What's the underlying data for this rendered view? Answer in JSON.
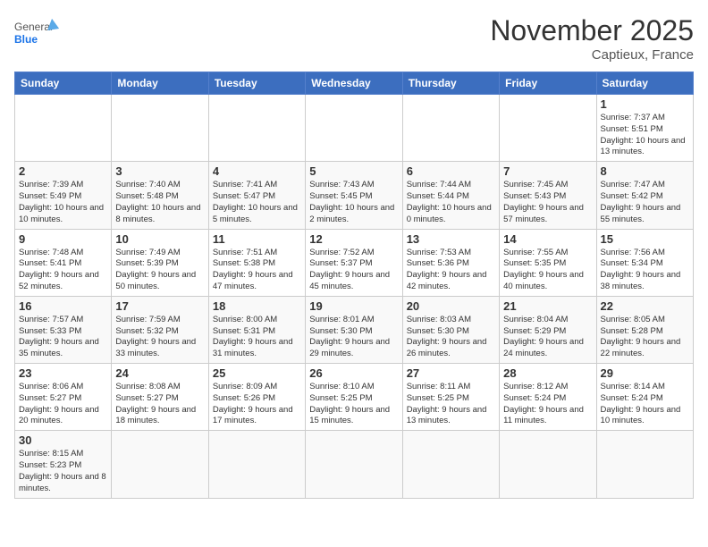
{
  "header": {
    "logo_general": "General",
    "logo_blue": "Blue",
    "month_title": "November 2025",
    "location": "Captieux, France"
  },
  "days_of_week": [
    "Sunday",
    "Monday",
    "Tuesday",
    "Wednesday",
    "Thursday",
    "Friday",
    "Saturday"
  ],
  "weeks": [
    [
      {
        "day": "",
        "info": ""
      },
      {
        "day": "",
        "info": ""
      },
      {
        "day": "",
        "info": ""
      },
      {
        "day": "",
        "info": ""
      },
      {
        "day": "",
        "info": ""
      },
      {
        "day": "",
        "info": ""
      },
      {
        "day": "1",
        "info": "Sunrise: 7:37 AM\nSunset: 5:51 PM\nDaylight: 10 hours and 13 minutes."
      }
    ],
    [
      {
        "day": "2",
        "info": "Sunrise: 7:39 AM\nSunset: 5:49 PM\nDaylight: 10 hours and 10 minutes."
      },
      {
        "day": "3",
        "info": "Sunrise: 7:40 AM\nSunset: 5:48 PM\nDaylight: 10 hours and 8 minutes."
      },
      {
        "day": "4",
        "info": "Sunrise: 7:41 AM\nSunset: 5:47 PM\nDaylight: 10 hours and 5 minutes."
      },
      {
        "day": "5",
        "info": "Sunrise: 7:43 AM\nSunset: 5:45 PM\nDaylight: 10 hours and 2 minutes."
      },
      {
        "day": "6",
        "info": "Sunrise: 7:44 AM\nSunset: 5:44 PM\nDaylight: 10 hours and 0 minutes."
      },
      {
        "day": "7",
        "info": "Sunrise: 7:45 AM\nSunset: 5:43 PM\nDaylight: 9 hours and 57 minutes."
      },
      {
        "day": "8",
        "info": "Sunrise: 7:47 AM\nSunset: 5:42 PM\nDaylight: 9 hours and 55 minutes."
      }
    ],
    [
      {
        "day": "9",
        "info": "Sunrise: 7:48 AM\nSunset: 5:41 PM\nDaylight: 9 hours and 52 minutes."
      },
      {
        "day": "10",
        "info": "Sunrise: 7:49 AM\nSunset: 5:39 PM\nDaylight: 9 hours and 50 minutes."
      },
      {
        "day": "11",
        "info": "Sunrise: 7:51 AM\nSunset: 5:38 PM\nDaylight: 9 hours and 47 minutes."
      },
      {
        "day": "12",
        "info": "Sunrise: 7:52 AM\nSunset: 5:37 PM\nDaylight: 9 hours and 45 minutes."
      },
      {
        "day": "13",
        "info": "Sunrise: 7:53 AM\nSunset: 5:36 PM\nDaylight: 9 hours and 42 minutes."
      },
      {
        "day": "14",
        "info": "Sunrise: 7:55 AM\nSunset: 5:35 PM\nDaylight: 9 hours and 40 minutes."
      },
      {
        "day": "15",
        "info": "Sunrise: 7:56 AM\nSunset: 5:34 PM\nDaylight: 9 hours and 38 minutes."
      }
    ],
    [
      {
        "day": "16",
        "info": "Sunrise: 7:57 AM\nSunset: 5:33 PM\nDaylight: 9 hours and 35 minutes."
      },
      {
        "day": "17",
        "info": "Sunrise: 7:59 AM\nSunset: 5:32 PM\nDaylight: 9 hours and 33 minutes."
      },
      {
        "day": "18",
        "info": "Sunrise: 8:00 AM\nSunset: 5:31 PM\nDaylight: 9 hours and 31 minutes."
      },
      {
        "day": "19",
        "info": "Sunrise: 8:01 AM\nSunset: 5:30 PM\nDaylight: 9 hours and 29 minutes."
      },
      {
        "day": "20",
        "info": "Sunrise: 8:03 AM\nSunset: 5:30 PM\nDaylight: 9 hours and 26 minutes."
      },
      {
        "day": "21",
        "info": "Sunrise: 8:04 AM\nSunset: 5:29 PM\nDaylight: 9 hours and 24 minutes."
      },
      {
        "day": "22",
        "info": "Sunrise: 8:05 AM\nSunset: 5:28 PM\nDaylight: 9 hours and 22 minutes."
      }
    ],
    [
      {
        "day": "23",
        "info": "Sunrise: 8:06 AM\nSunset: 5:27 PM\nDaylight: 9 hours and 20 minutes."
      },
      {
        "day": "24",
        "info": "Sunrise: 8:08 AM\nSunset: 5:27 PM\nDaylight: 9 hours and 18 minutes."
      },
      {
        "day": "25",
        "info": "Sunrise: 8:09 AM\nSunset: 5:26 PM\nDaylight: 9 hours and 17 minutes."
      },
      {
        "day": "26",
        "info": "Sunrise: 8:10 AM\nSunset: 5:25 PM\nDaylight: 9 hours and 15 minutes."
      },
      {
        "day": "27",
        "info": "Sunrise: 8:11 AM\nSunset: 5:25 PM\nDaylight: 9 hours and 13 minutes."
      },
      {
        "day": "28",
        "info": "Sunrise: 8:12 AM\nSunset: 5:24 PM\nDaylight: 9 hours and 11 minutes."
      },
      {
        "day": "29",
        "info": "Sunrise: 8:14 AM\nSunset: 5:24 PM\nDaylight: 9 hours and 10 minutes."
      }
    ],
    [
      {
        "day": "30",
        "info": "Sunrise: 8:15 AM\nSunset: 5:23 PM\nDaylight: 9 hours and 8 minutes."
      },
      {
        "day": "",
        "info": ""
      },
      {
        "day": "",
        "info": ""
      },
      {
        "day": "",
        "info": ""
      },
      {
        "day": "",
        "info": ""
      },
      {
        "day": "",
        "info": ""
      },
      {
        "day": "",
        "info": ""
      }
    ]
  ]
}
